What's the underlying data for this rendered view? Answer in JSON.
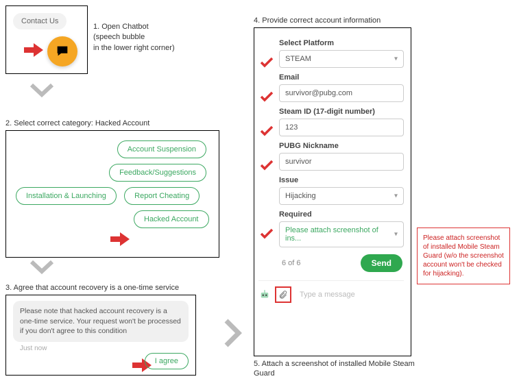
{
  "step1": {
    "title": "1. Open Chatbot",
    "subtitle": "(speech bubble\nin the lower right corner)",
    "contact_label": "Contact Us"
  },
  "step2": {
    "title": "2. Select correct category: Hacked Account",
    "pills": {
      "suspension": "Account Suspension",
      "feedback": "Feedback/Suggestions",
      "install": "Installation & Launching",
      "cheat": "Report Cheating",
      "hacked": "Hacked Account"
    }
  },
  "step3": {
    "title": "3. Agree that account recovery is a one-time service",
    "message": "Please note that hacked account recovery is a one-time service. Your request won't be processed if you don't agree to this condition",
    "timestamp": "Just now",
    "agree_label": "I agree"
  },
  "step4": {
    "title": "4. Provide correct account information",
    "fields": {
      "platform_label": "Select Platform",
      "platform_value": "STEAM",
      "email_label": "Email",
      "email_value": "survivor@pubg.com",
      "steamid_label": "Steam ID (17-digit number)",
      "steamid_value": "123",
      "nickname_label": "PUBG Nickname",
      "nickname_value": "survivor",
      "issue_label": "Issue",
      "issue_value": "Hijacking",
      "required_label": "Required",
      "required_value": "Please attach screenshot of ins..."
    },
    "progress": "6 of 6",
    "send_label": "Send",
    "composer_placeholder": "Type a message",
    "tooltip": "Please attach screenshot of installed Mobile Steam Guard (w/o the screenshot account won't be checked for hijacking)."
  },
  "step5": {
    "title": "5. Attach a screenshot of installed Mobile Steam Guard"
  }
}
